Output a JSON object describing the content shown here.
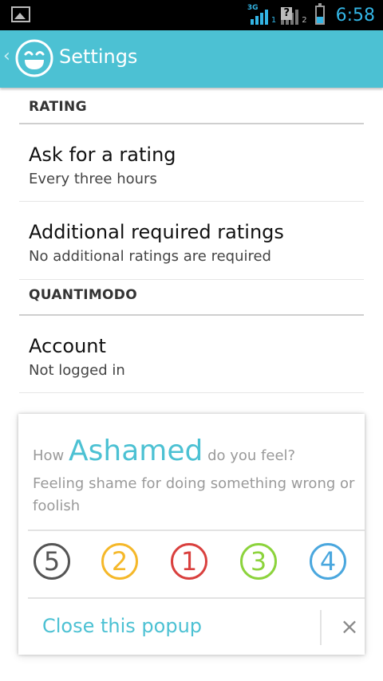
{
  "status_bar": {
    "network_label": "3G",
    "sim1": "1",
    "sim2": "2",
    "sim2_status": "?",
    "battery_level": 0.4,
    "time": "6:58"
  },
  "action_bar": {
    "title": "Settings",
    "back_glyph": "‹",
    "logo_icon": "smiley-face-icon"
  },
  "settings": {
    "categories": [
      {
        "title": "RATING",
        "items": [
          {
            "title": "Ask for a rating",
            "summary": "Every three hours"
          },
          {
            "title": "Additional required ratings",
            "summary": "No additional ratings are required"
          }
        ]
      },
      {
        "title": "QUANTIMODO",
        "items": [
          {
            "title": "Account",
            "summary": "Not logged in"
          }
        ]
      }
    ]
  },
  "popup": {
    "question_prefix": "How",
    "emotion": "Ashamed",
    "question_suffix": "do you feel?",
    "description": "Feeling shame for doing something wrong or foolish",
    "ratings": [
      {
        "label": "5",
        "color": "#555555"
      },
      {
        "label": "2",
        "color": "#f5b829"
      },
      {
        "label": "1",
        "color": "#d9403e"
      },
      {
        "label": "3",
        "color": "#8cd33c"
      },
      {
        "label": "4",
        "color": "#4aa7de"
      }
    ],
    "close_label": "Close this popup",
    "close_icon": "×"
  },
  "colors": {
    "accent": "#4cc1d3",
    "status_blue": "#33b5e5"
  }
}
